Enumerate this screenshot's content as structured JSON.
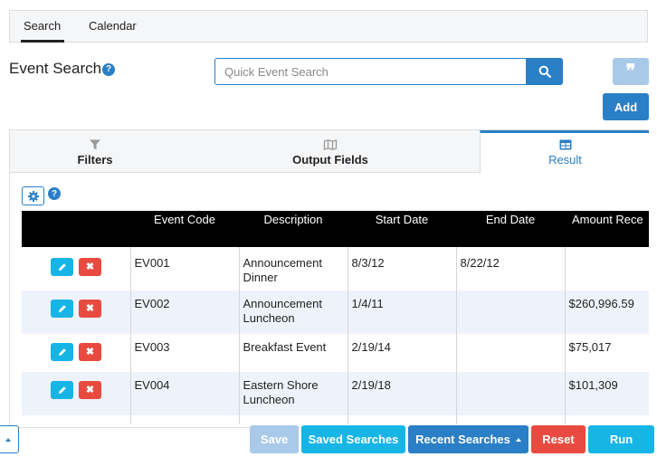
{
  "top_tabs": {
    "search": "Search",
    "calendar": "Calendar"
  },
  "page": {
    "title": "Event Search",
    "help": "?"
  },
  "search": {
    "placeholder": "Quick Event Search",
    "value": ""
  },
  "buttons": {
    "add": "Add",
    "quote": "❞"
  },
  "panel_tabs": {
    "filters": "Filters",
    "output_fields": "Output Fields",
    "result": "Result"
  },
  "grid": {
    "help": "?",
    "columns": [
      "",
      "Event Code",
      "Description",
      "Start Date",
      "End Date",
      "Amount Rece"
    ],
    "rows": [
      {
        "code": "EV001",
        "description_l1": "Announcement",
        "description_l2": "Dinner",
        "start": "8/3/12",
        "end": "8/22/12",
        "amount": ""
      },
      {
        "code": "EV002",
        "description_l1": "Announcement",
        "description_l2": "Luncheon",
        "start": "1/4/11",
        "end": "",
        "amount": "$260,996.59"
      },
      {
        "code": "EV003",
        "description_l1": "Breakfast Event",
        "description_l2": "",
        "start": "2/19/14",
        "end": "",
        "amount": "$75,017"
      },
      {
        "code": "EV004",
        "description_l1": "Eastern Shore",
        "description_l2": "Luncheon",
        "start": "2/19/18",
        "end": "",
        "amount": "$101,309"
      }
    ],
    "delete_glyph": "✖"
  },
  "footer": {
    "save": "Save",
    "saved_searches": "Saved Searches",
    "recent_searches": "Recent Searches",
    "reset": "Reset",
    "run": "Run"
  },
  "colors": {
    "primary": "#2a7fc6",
    "info": "#17b5e6",
    "danger": "#e84a3f",
    "disabled": "#a9c9e9",
    "header_bg": "#000000"
  }
}
